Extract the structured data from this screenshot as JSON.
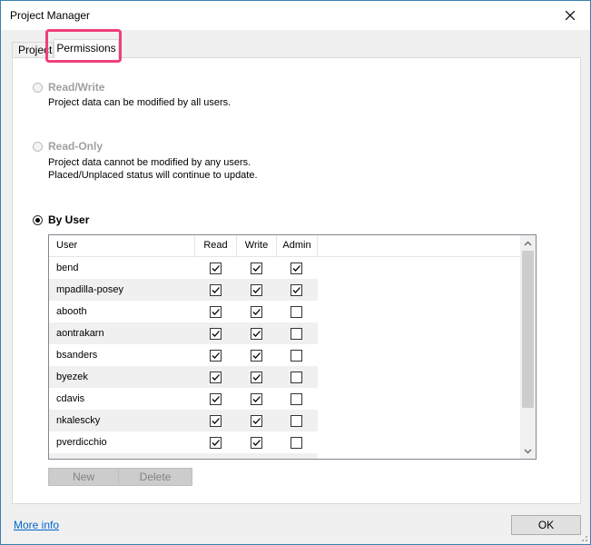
{
  "window": {
    "title": "Project Manager"
  },
  "tabs": [
    {
      "label": "Projects",
      "active": false
    },
    {
      "label": "Permissions",
      "active": true
    }
  ],
  "options": [
    {
      "label": "Read/Write",
      "description": [
        "Project data can be modified by all users."
      ],
      "selected": false,
      "enabled": false
    },
    {
      "label": "Read-Only",
      "description": [
        "Project data cannot be modified by any users.",
        "Placed/Unplaced status will continue to update."
      ],
      "selected": false,
      "enabled": false
    },
    {
      "label": "By User",
      "description": [],
      "selected": true,
      "enabled": true
    }
  ],
  "grid": {
    "columns": [
      "User",
      "Read",
      "Write",
      "Admin"
    ],
    "rows": [
      {
        "user": "bend",
        "read": true,
        "write": true,
        "admin": true
      },
      {
        "user": "mpadilla-posey",
        "read": true,
        "write": true,
        "admin": true
      },
      {
        "user": "abooth",
        "read": true,
        "write": true,
        "admin": false
      },
      {
        "user": "aontrakarn",
        "read": true,
        "write": true,
        "admin": false
      },
      {
        "user": "bsanders",
        "read": true,
        "write": true,
        "admin": false
      },
      {
        "user": "byezek",
        "read": true,
        "write": true,
        "admin": false
      },
      {
        "user": "cdavis",
        "read": true,
        "write": true,
        "admin": false
      },
      {
        "user": "nkalescky",
        "read": true,
        "write": true,
        "admin": false
      },
      {
        "user": "pverdicchio",
        "read": true,
        "write": true,
        "admin": false
      }
    ]
  },
  "buttons": {
    "new": "New",
    "delete": "Delete",
    "ok": "OK"
  },
  "links": {
    "more_info": "More info"
  },
  "colors": {
    "highlight": "#ef3f79",
    "link": "#0066cc",
    "window_border": "#3c7fb1"
  }
}
